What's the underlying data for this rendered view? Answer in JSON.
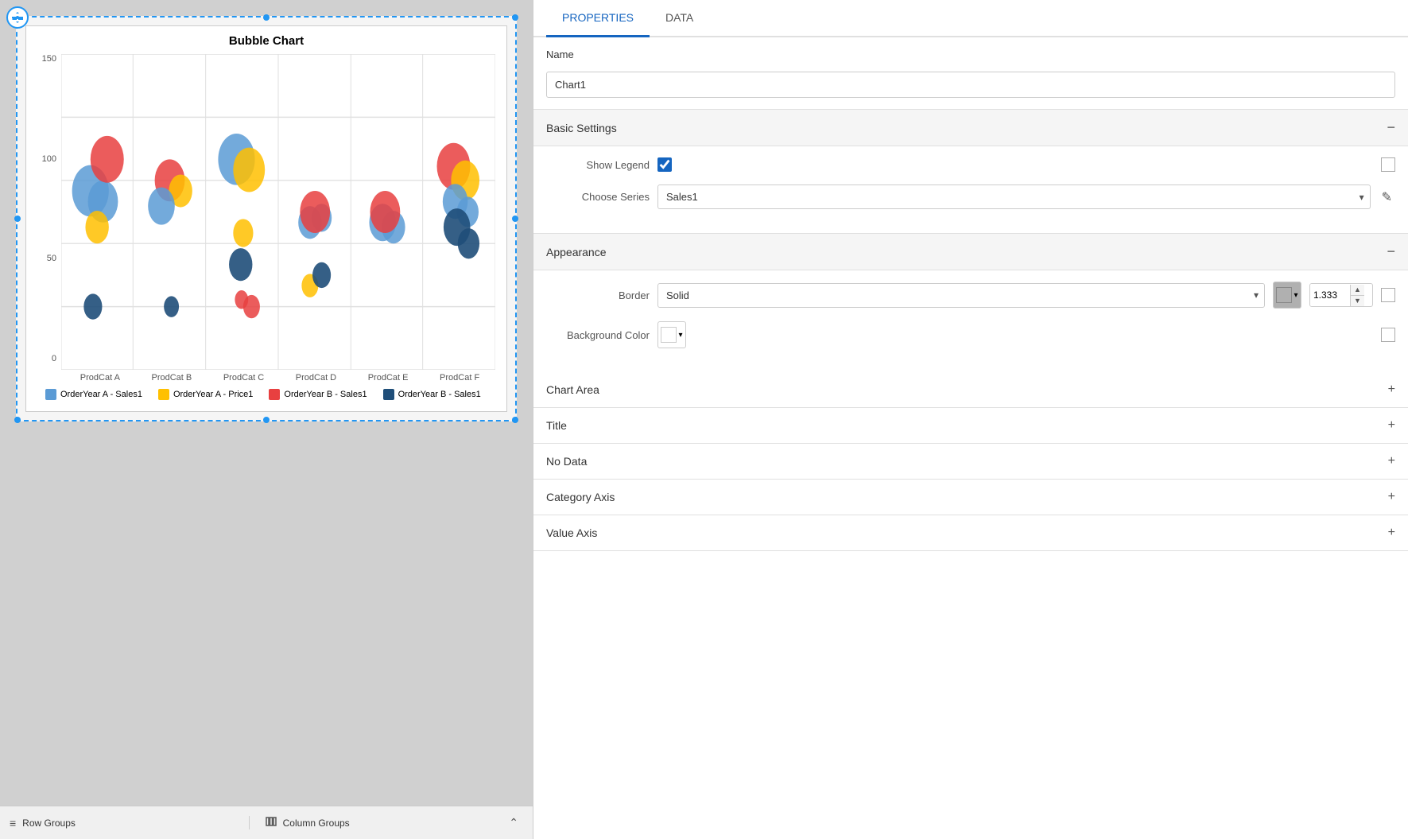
{
  "left": {
    "chart": {
      "title": "Bubble Chart",
      "y_axis_labels": [
        "150",
        "100",
        "50",
        "0"
      ],
      "x_axis_labels": [
        "ProdCat A",
        "ProdCat B",
        "ProdCat C",
        "ProdCat D",
        "ProdCat E",
        "ProdCat F"
      ],
      "legend": [
        {
          "label": "OrderYear A - Sales1",
          "color": "#5B9BD5"
        },
        {
          "label": "OrderYear A - Price1",
          "color": "#FFC000"
        },
        {
          "label": "OrderYear B - Sales1",
          "color": "#E84040"
        },
        {
          "label": "OrderYear B - Sales1",
          "color": "#1F4E79"
        }
      ]
    }
  },
  "bottom_bar": {
    "row_groups_label": "Row Groups",
    "column_groups_label": "Column Groups"
  },
  "right": {
    "tabs": [
      {
        "label": "PROPERTIES"
      },
      {
        "label": "DATA"
      }
    ],
    "active_tab": "PROPERTIES",
    "name_section": {
      "label": "Name",
      "value": "Chart1"
    },
    "basic_settings": {
      "title": "Basic Settings",
      "show_legend_label": "Show Legend",
      "show_legend_checked": true,
      "choose_series_label": "Choose Series",
      "choose_series_value": "Sales1"
    },
    "appearance": {
      "title": "Appearance",
      "border_label": "Border",
      "border_style": "Solid",
      "border_color": "#b0b0b0",
      "border_width": "1.333",
      "bg_color_label": "Background Color"
    },
    "sections": [
      {
        "label": "Chart Area"
      },
      {
        "label": "Title"
      },
      {
        "label": "No Data"
      },
      {
        "label": "Category Axis"
      },
      {
        "label": "Value Axis"
      }
    ]
  }
}
